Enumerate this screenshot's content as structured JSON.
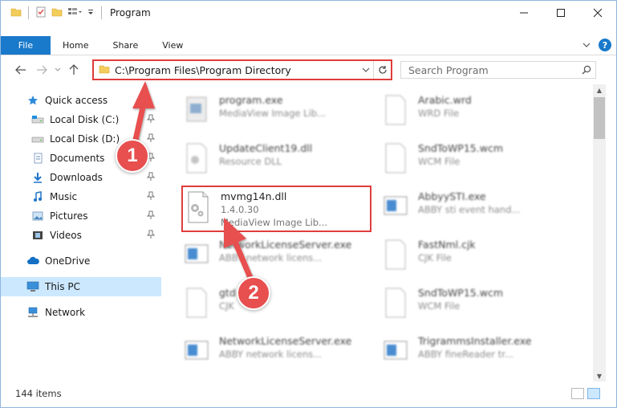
{
  "window": {
    "title": "Program",
    "caption_buttons": [
      "minimize-icon",
      "maximize-icon",
      "close-icon"
    ]
  },
  "ribbon": {
    "tabs": [
      "File",
      "Home",
      "Share",
      "View"
    ]
  },
  "nav": {
    "address": "C:\\Program Files\\Program Directory",
    "search_placeholder": "Search Program"
  },
  "sidebar": {
    "items": [
      {
        "label": "Quick access",
        "icon": "star-icon"
      },
      {
        "label": "Local Disk (C:)",
        "icon": "drive-icon",
        "pinned": true
      },
      {
        "label": "Local Disk (D:)",
        "icon": "drive-icon",
        "pinned": true
      },
      {
        "label": "Documents",
        "icon": "documents-icon",
        "pinned": true
      },
      {
        "label": "Downloads",
        "icon": "downloads-icon",
        "pinned": true
      },
      {
        "label": "Music",
        "icon": "music-icon",
        "pinned": true
      },
      {
        "label": "Pictures",
        "icon": "pictures-icon",
        "pinned": true
      },
      {
        "label": "Videos",
        "icon": "videos-icon",
        "pinned": true
      },
      {
        "label": "OneDrive",
        "icon": "cloud-icon"
      },
      {
        "label": "This PC",
        "icon": "computer-icon",
        "selected": true
      },
      {
        "label": "Network",
        "icon": "network-icon"
      }
    ]
  },
  "files": {
    "f1": {
      "name": "program.exe",
      "sub": "MediaView Image Lib..."
    },
    "f2": {
      "name": "Arabic.wrd",
      "sub": "WRD File"
    },
    "f3": {
      "name": "UpdateClient19.dll",
      "sub": "Resource DLL"
    },
    "f4": {
      "name": "SndToWP15.wcm",
      "sub": "WCM File"
    },
    "f5": {
      "name": "mvmg14n.dll",
      "sub": "1.4.0.30",
      "sub2": "MediaView Image Lib..."
    },
    "f6": {
      "name": "AbbyySTI.exe",
      "sub": "ABBY sti event hand..."
    },
    "f7": {
      "name": "NetworkLicenseServer.exe",
      "sub": "ABBY network licens..."
    },
    "f8": {
      "name": "FastNml.cjk",
      "sub": "CJK File"
    },
    "f9": {
      "name": "gtd",
      "sub": "CJK"
    },
    "f10": {
      "name": "SndToWP15.wcm",
      "sub": "WCM File"
    },
    "f11": {
      "name": "NetworkLicenseServer.exe",
      "sub": "ABBY network licens..."
    },
    "f12": {
      "name": "TrigrammsInstaller.exe",
      "sub": "ABBY fineReader tr..."
    }
  },
  "status": {
    "count": "144 items"
  },
  "annotations": {
    "step1": "1",
    "step2": "2",
    "color": "#e84f4f"
  }
}
